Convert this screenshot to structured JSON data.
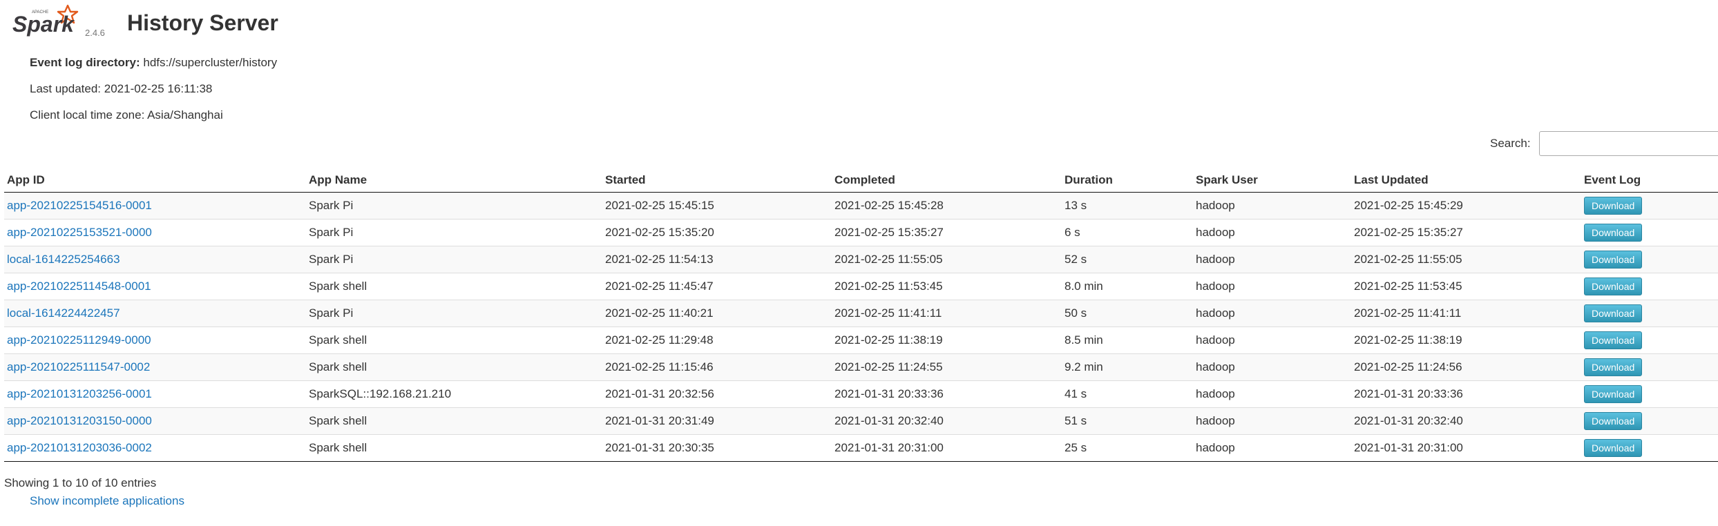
{
  "header": {
    "version": "2.4.6",
    "title": "History Server",
    "logo_small_text": "APACHE",
    "logo_text": "Spark"
  },
  "info": {
    "event_log_label": "Event log directory:",
    "event_log_value": "hdfs://supercluster/history",
    "last_updated": "Last updated: 2021-02-25 16:11:38",
    "timezone": "Client local time zone: Asia/Shanghai"
  },
  "search": {
    "label": "Search:",
    "value": ""
  },
  "table": {
    "columns": [
      "App ID",
      "App Name",
      "Started",
      "Completed",
      "Duration",
      "Spark User",
      "Last Updated",
      "Event Log"
    ],
    "rows": [
      {
        "app_id": "app-20210225154516-0001",
        "app_name": "Spark Pi",
        "started": "2021-02-25 15:45:15",
        "completed": "2021-02-25 15:45:28",
        "duration": "13 s",
        "user": "hadoop",
        "last_updated": "2021-02-25 15:45:29",
        "event_log": "Download"
      },
      {
        "app_id": "app-20210225153521-0000",
        "app_name": "Spark Pi",
        "started": "2021-02-25 15:35:20",
        "completed": "2021-02-25 15:35:27",
        "duration": "6 s",
        "user": "hadoop",
        "last_updated": "2021-02-25 15:35:27",
        "event_log": "Download"
      },
      {
        "app_id": "local-1614225254663",
        "app_name": "Spark Pi",
        "started": "2021-02-25 11:54:13",
        "completed": "2021-02-25 11:55:05",
        "duration": "52 s",
        "user": "hadoop",
        "last_updated": "2021-02-25 11:55:05",
        "event_log": "Download"
      },
      {
        "app_id": "app-20210225114548-0001",
        "app_name": "Spark shell",
        "started": "2021-02-25 11:45:47",
        "completed": "2021-02-25 11:53:45",
        "duration": "8.0 min",
        "user": "hadoop",
        "last_updated": "2021-02-25 11:53:45",
        "event_log": "Download"
      },
      {
        "app_id": "local-1614224422457",
        "app_name": "Spark Pi",
        "started": "2021-02-25 11:40:21",
        "completed": "2021-02-25 11:41:11",
        "duration": "50 s",
        "user": "hadoop",
        "last_updated": "2021-02-25 11:41:11",
        "event_log": "Download"
      },
      {
        "app_id": "app-20210225112949-0000",
        "app_name": "Spark shell",
        "started": "2021-02-25 11:29:48",
        "completed": "2021-02-25 11:38:19",
        "duration": "8.5 min",
        "user": "hadoop",
        "last_updated": "2021-02-25 11:38:19",
        "event_log": "Download"
      },
      {
        "app_id": "app-20210225111547-0002",
        "app_name": "Spark shell",
        "started": "2021-02-25 11:15:46",
        "completed": "2021-02-25 11:24:55",
        "duration": "9.2 min",
        "user": "hadoop",
        "last_updated": "2021-02-25 11:24:56",
        "event_log": "Download"
      },
      {
        "app_id": "app-20210131203256-0001",
        "app_name": "SparkSQL::192.168.21.210",
        "started": "2021-01-31 20:32:56",
        "completed": "2021-01-31 20:33:36",
        "duration": "41 s",
        "user": "hadoop",
        "last_updated": "2021-01-31 20:33:36",
        "event_log": "Download"
      },
      {
        "app_id": "app-20210131203150-0000",
        "app_name": "Spark shell",
        "started": "2021-01-31 20:31:49",
        "completed": "2021-01-31 20:32:40",
        "duration": "51 s",
        "user": "hadoop",
        "last_updated": "2021-01-31 20:32:40",
        "event_log": "Download"
      },
      {
        "app_id": "app-20210131203036-0002",
        "app_name": "Spark shell",
        "started": "2021-01-31 20:30:35",
        "completed": "2021-01-31 20:31:00",
        "duration": "25 s",
        "user": "hadoop",
        "last_updated": "2021-01-31 20:31:00",
        "event_log": "Download"
      }
    ]
  },
  "footer": {
    "entries_info": "Showing 1 to 10 of 10 entries",
    "incomplete_link": "Show incomplete applications"
  },
  "colors": {
    "link": "#1b75bb",
    "button": "#3fa5c9",
    "logo_orange": "#e25a1c"
  }
}
